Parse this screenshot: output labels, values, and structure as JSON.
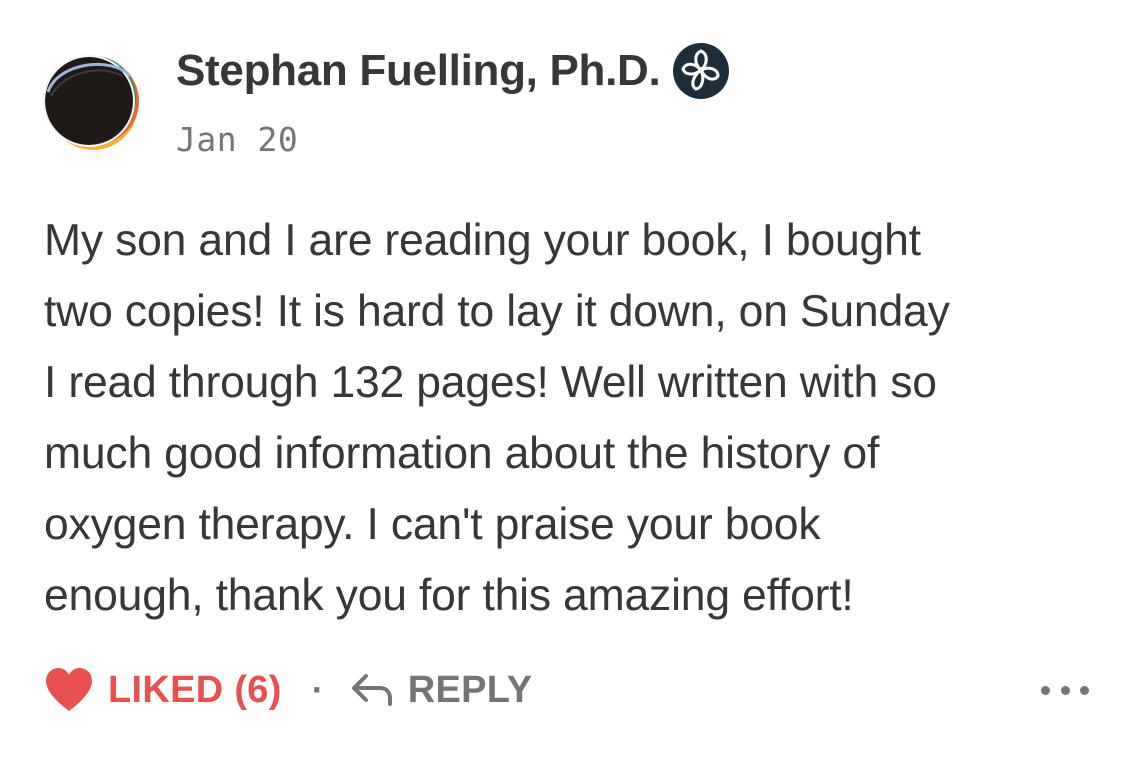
{
  "comment": {
    "author": {
      "name": "Stephan Fuelling, Ph.D.",
      "avatar_icon": "avatar-image",
      "badge_icon": "flower-badge-icon"
    },
    "date": "Jan 20",
    "body_lines": [
      "My son and I are reading your book, I bought",
      "two copies! It is hard to lay it down, on Sunday",
      "I read through 132 pages! Well written with so",
      "much good information about the history of",
      "oxygen therapy. I can't praise your book",
      "enough, thank you for this amazing effort!"
    ],
    "actions": {
      "like_label": "LIKED (6)",
      "like_icon": "heart-icon",
      "separator": "·",
      "reply_label": "REPLY",
      "reply_icon": "reply-arrow-icon",
      "more_icon": "more-dots-icon"
    }
  },
  "colors": {
    "text": "#363737",
    "muted": "#757575",
    "liked": "#e8514f"
  }
}
